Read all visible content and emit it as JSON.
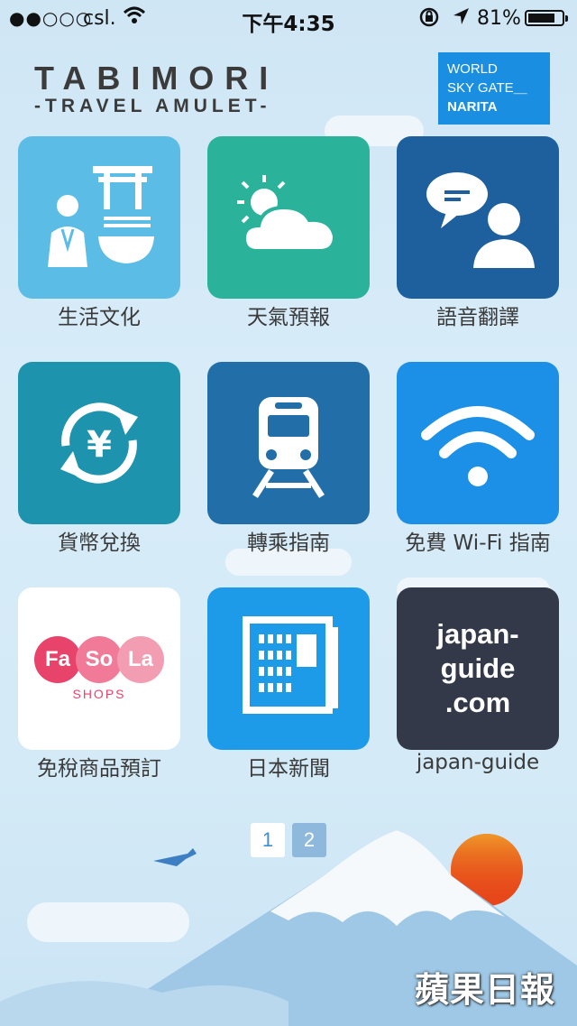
{
  "status_bar": {
    "signal": "●●○○○",
    "carrier": "csl.",
    "time": "下午4:35",
    "battery_pct": "81%",
    "battery_level": 0.81
  },
  "header": {
    "title": "TABIMORI",
    "subtitle": "-TRAVEL AMULET-",
    "badge_line1": "WORLD",
    "badge_line2": "SKY GATE＿",
    "badge_line3": "NARITA",
    "badge_color": "#1a8ee0"
  },
  "apps": [
    {
      "label": "生活文化",
      "icon": "culture-icon",
      "color": "#5bbde6"
    },
    {
      "label": "天氣預報",
      "icon": "weather-icon",
      "color": "#2bb29b"
    },
    {
      "label": "語音翻譯",
      "icon": "translation-icon",
      "color": "#1e5f9e"
    },
    {
      "label": "貨幣兌換",
      "icon": "currency-exchange-icon",
      "color": "#1e93ae"
    },
    {
      "label": "轉乘指南",
      "icon": "train-icon",
      "color": "#226ea9"
    },
    {
      "label": "免費 Wi-Fi 指南",
      "icon": "wifi-icon",
      "color": "#1c8fe6"
    },
    {
      "label": "免稅商品預訂",
      "icon": "fasola-logo",
      "color": "#ffffff",
      "logo_text": [
        "Fa",
        "So",
        "La"
      ],
      "logo_sub": "SHOPS"
    },
    {
      "label": "日本新聞",
      "icon": "newspaper-icon",
      "color": "#1e9be8"
    },
    {
      "label": "japan-guide",
      "icon": "japan-guide-logo",
      "color": "#34394a",
      "logo_lines": [
        "japan-",
        "guide",
        ".com"
      ]
    }
  ],
  "pager": {
    "page1": "1",
    "page2": "2"
  },
  "watermark": "蘋果日報"
}
